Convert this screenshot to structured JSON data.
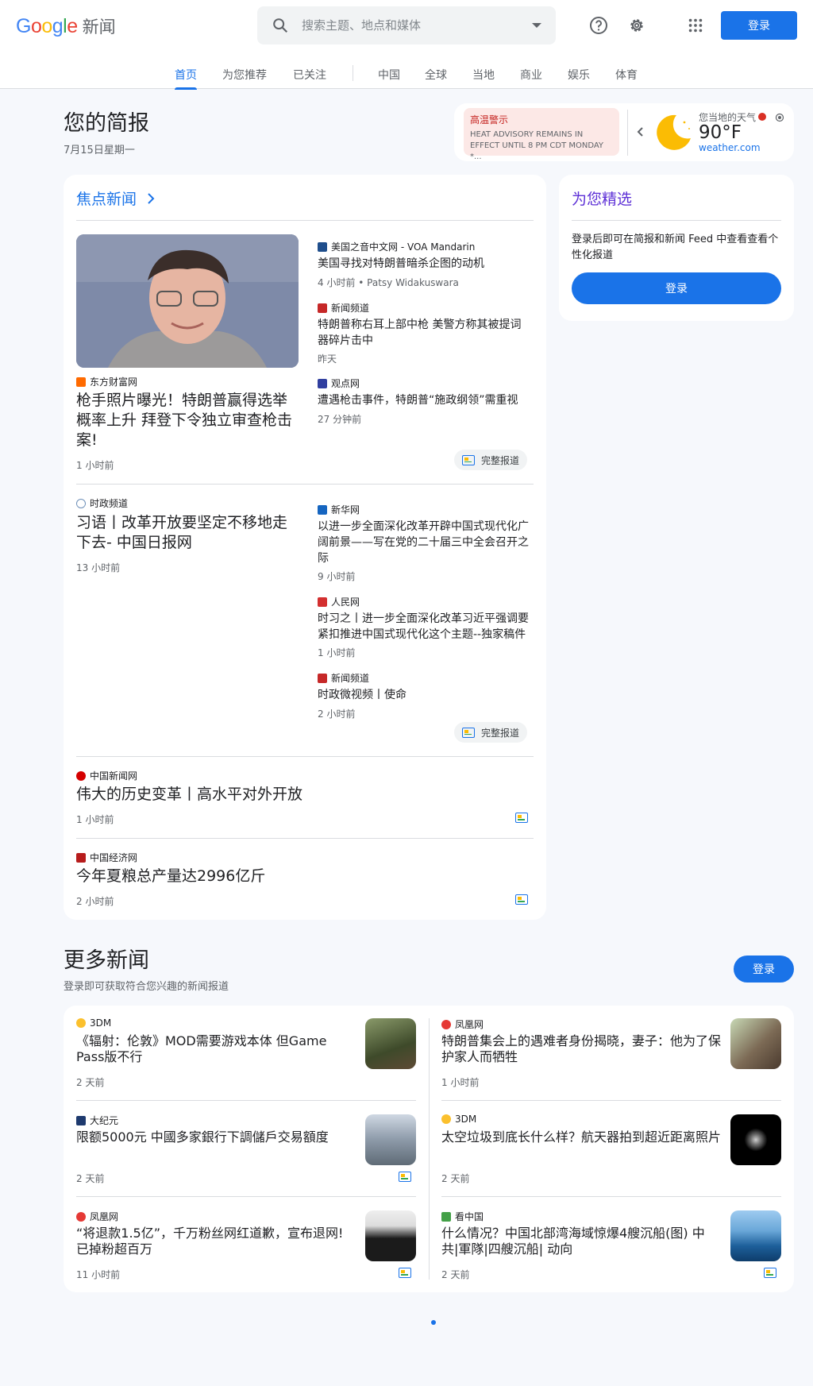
{
  "header": {
    "logo_word": "Google",
    "logo_suffix": "新闻",
    "search_placeholder": "搜索主题、地点和媒体",
    "signin_label": "登录"
  },
  "tabs": [
    "首页",
    "为您推荐",
    "已关注",
    "中国",
    "全球",
    "当地",
    "商业",
    "娱乐",
    "体育"
  ],
  "briefing": {
    "title": "您的简报",
    "date": "7月15日星期一"
  },
  "weather": {
    "alert_title": "高温警示",
    "alert_text": "HEAT ADVISORY REMAINS IN EFFECT UNTIL 8 PM CDT MONDAY *...",
    "label": "您当地的天气",
    "temp": "90°F",
    "source": "weather.com"
  },
  "top_stories": {
    "title": "焦点新闻",
    "full_coverage": "完整报道",
    "cluster1": {
      "main": {
        "source": "东方财富网",
        "title": "枪手照片曝光！特朗普赢得选举概率上升 拜登下令独立审查枪击案!",
        "time": "1 小时前"
      },
      "side": [
        {
          "source": "美国之音中文网 - VOA Mandarin",
          "title": "美国寻找对特朗普暗杀企图的动机",
          "time": "4 小时前 • Patsy Widakuswara"
        },
        {
          "source": "新闻频道",
          "title": "特朗普称右耳上部中枪 美警方称其被提词器碎片击中",
          "time": "昨天"
        },
        {
          "source": "观点网",
          "title": "遭遇枪击事件，特朗普“施政纲领”需重视",
          "time": "27 分钟前"
        }
      ]
    },
    "cluster2": {
      "main": {
        "source": "时政频道",
        "title": "习语丨改革开放要坚定不移地走下去- 中国日报网",
        "time": "13 小时前"
      },
      "side": [
        {
          "source": "新华网",
          "title": "以进一步全面深化改革开辟中国式现代化广阔前景——写在党的二十届三中全会召开之际",
          "time": "9 小时前"
        },
        {
          "source": "人民网",
          "title": "时习之丨进一步全面深化改革习近平强调要紧扣推进中国式现代化这个主题--独家稿件",
          "time": "1 小时前"
        },
        {
          "source": "新闻频道",
          "title": "时政微视频丨使命",
          "time": "2 小时前"
        }
      ]
    },
    "singles": [
      {
        "source": "中国新闻网",
        "title": "伟大的历史变革丨高水平对外开放",
        "time": "1 小时前"
      },
      {
        "source": "中国经济网",
        "title": "今年夏粮总产量达2996亿斤",
        "time": "2 小时前"
      }
    ]
  },
  "picks": {
    "title": "为您精选",
    "text": "登录后即可在简报和新闻 Feed 中查看查看个性化报道",
    "button": "登录"
  },
  "more_news": {
    "title": "更多新闻",
    "subtitle": "登录即可获取符合您兴趣的新闻报道",
    "signin": "登录",
    "items": [
      {
        "source": "3DM",
        "title": "《辐射：伦敦》MOD需要游戏本体 但Game Pass版不行",
        "time": "2 天前"
      },
      {
        "source": "凤凰网",
        "title": "特朗普集会上的遇难者身份揭晓，妻子：他为了保护家人而牺牲",
        "time": "1 小时前"
      },
      {
        "source": "大纪元",
        "title": "限额5000元 中國多家銀行下調儲戶交易額度",
        "time": "2 天前"
      },
      {
        "source": "3DM",
        "title": "太空垃圾到底长什么样？航天器拍到超近距离照片",
        "time": "2 天前"
      },
      {
        "source": "凤凰网",
        "title": "“将退款1.5亿”，千万粉丝网红道歉，宣布退网!已掉粉超百万",
        "time": "11 小时前"
      },
      {
        "source": "看中国",
        "title": "什么情况？中国北部湾海域惊爆4艘沉船(图) 中共|軍隊|四艘沉船| 动向",
        "time": "2 天前"
      }
    ]
  },
  "colors": {
    "accent": "#1a73e8",
    "picks_title": "#5c2fd6",
    "alert_bg": "#fce8e6"
  },
  "icons": [
    "search-icon",
    "help-icon",
    "gear-icon",
    "apps-grid-icon",
    "chevron-right-icon",
    "chevron-left-icon",
    "moon-icon",
    "location-icon",
    "full-coverage-icon"
  ]
}
